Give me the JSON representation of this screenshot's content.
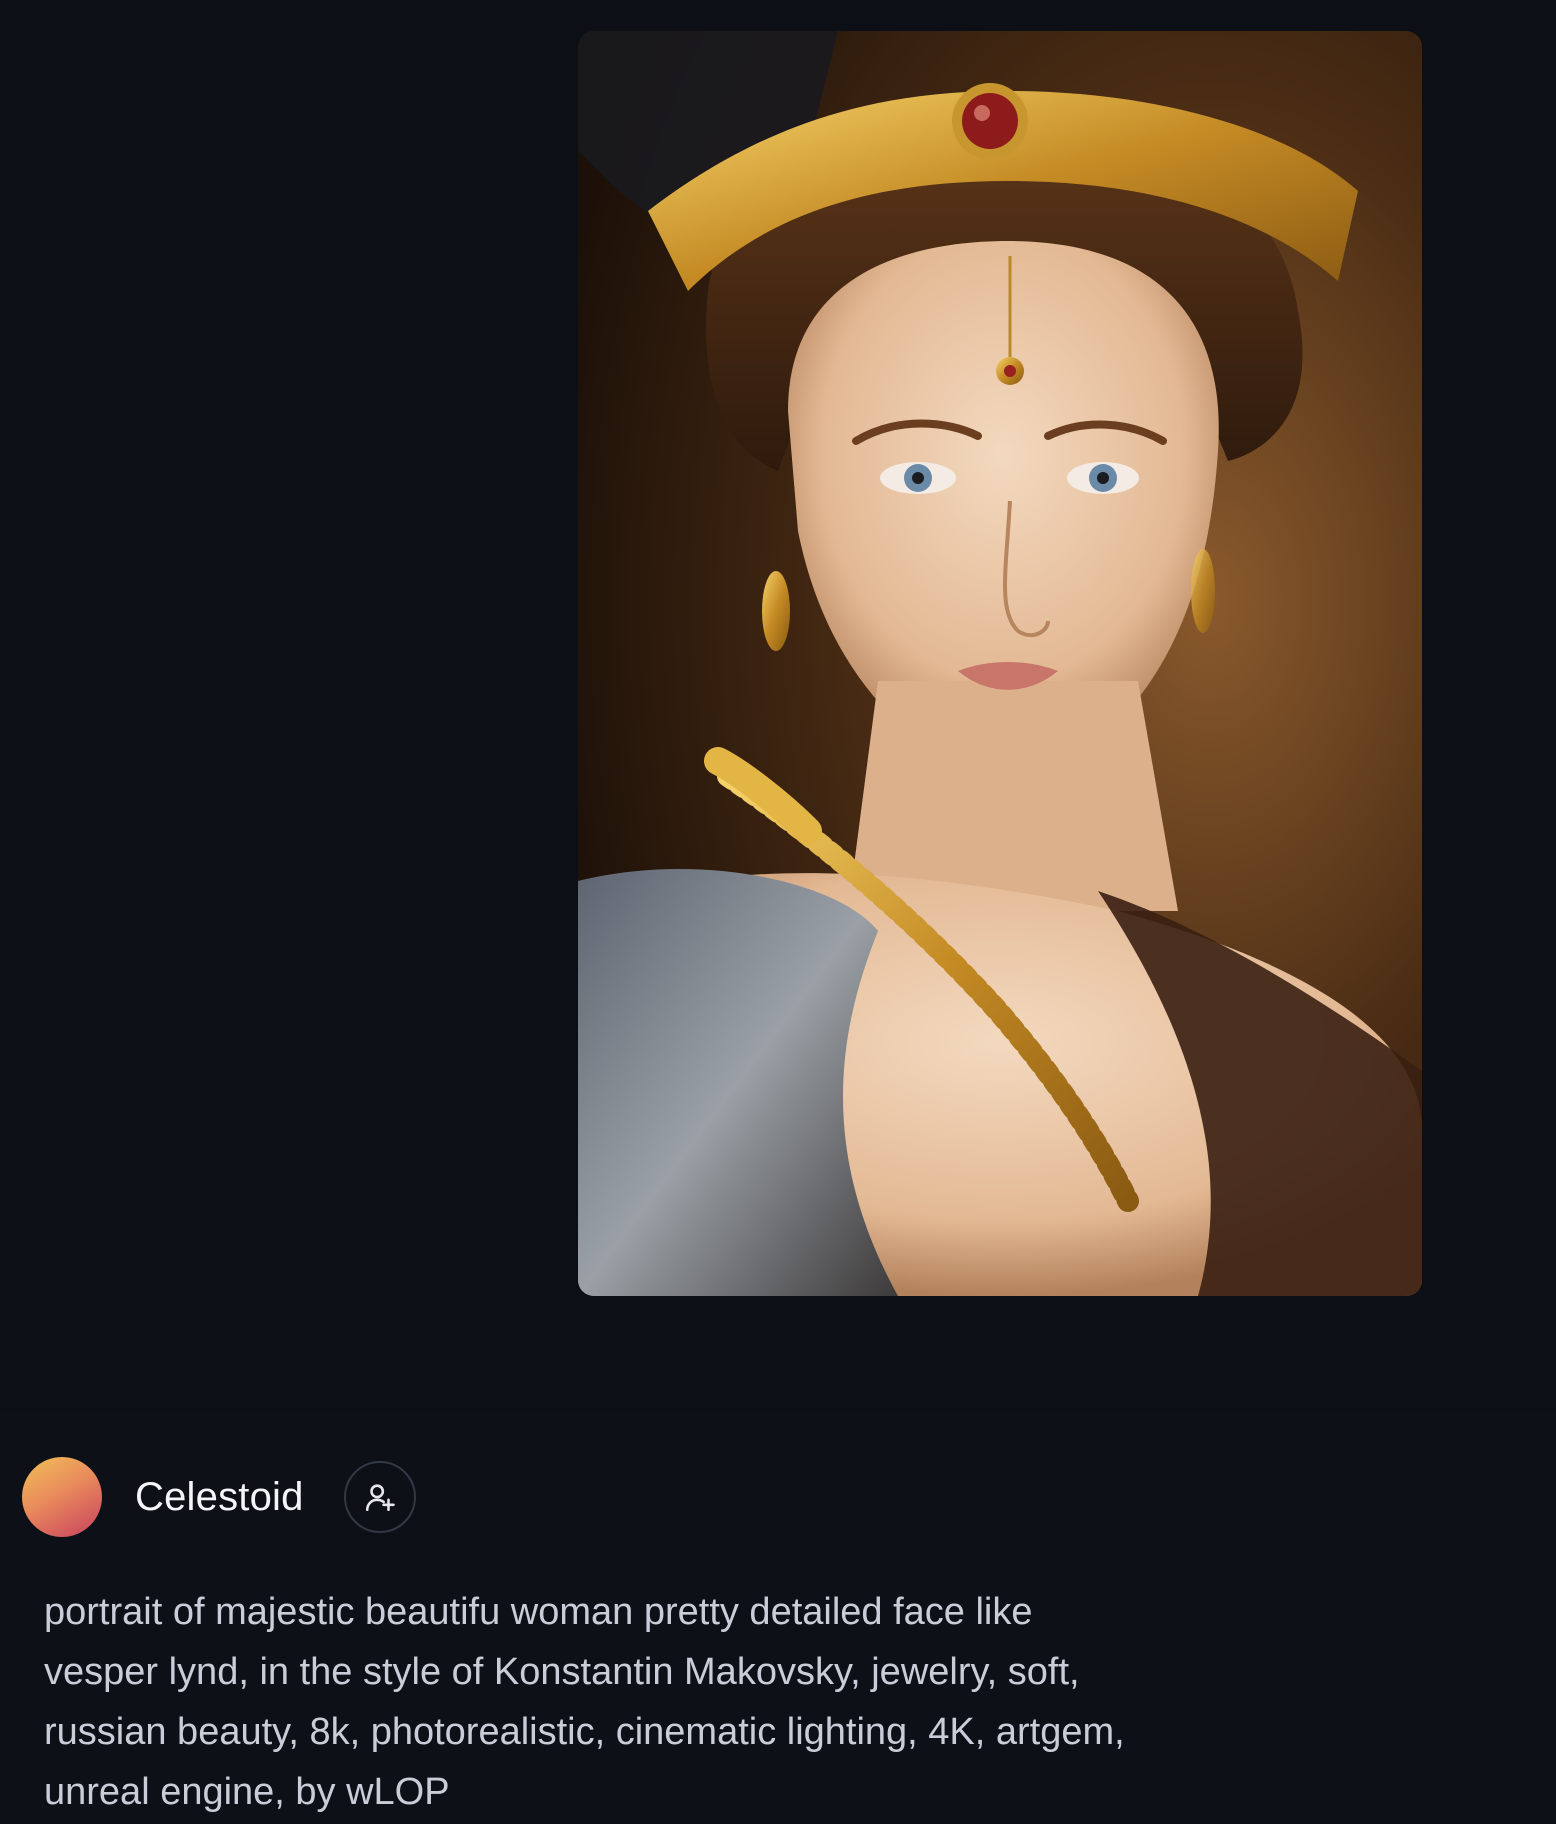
{
  "artwork": {
    "icon": "portrait-image"
  },
  "author": {
    "name": "Celestoid",
    "avatar_gradient": [
      "#f2c057",
      "#e98b5c",
      "#c8405f"
    ],
    "follow_icon": "user-plus-icon"
  },
  "prompt": {
    "text": "portrait of majestic beautifu woman pretty detailed face like\nvesper lynd, in the style of Konstantin Makovsky, jewelry, soft,\nrussian beauty, 8k, photorealistic, cinematic lighting, 4K, artgem,\nunreal engine, by wLOP"
  },
  "colors": {
    "background": "#0d1017",
    "text_primary": "#f4f5f8",
    "text_secondary": "#c9cdd8"
  }
}
